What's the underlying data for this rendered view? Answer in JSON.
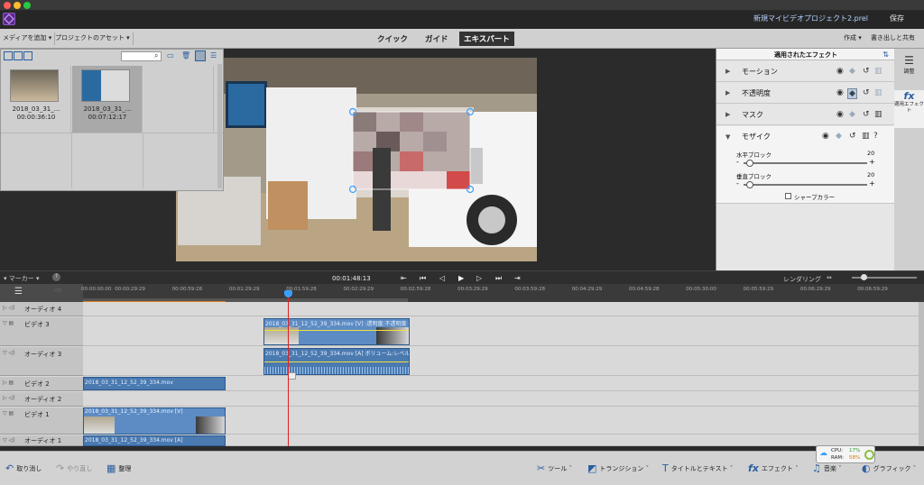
{
  "app": {
    "doc_title": "新規マイビデオプロジェクト2.prel",
    "save_label": "保存"
  },
  "tabbar": {
    "add_media": "メディアを追加",
    "project_assets": "プロジェクトのアセット",
    "modes": [
      "クイック",
      "ガイド",
      "エキスパート"
    ],
    "active_mode": "エキスパート",
    "create": "作成",
    "export_share": "書き出しと共有"
  },
  "assets": [
    {
      "name": "2018_03_31_...",
      "duration": "00:00:36:10"
    },
    {
      "name": "2018_03_31_...",
      "duration": "00:07:12:17"
    }
  ],
  "effects_panel": {
    "title": "適用されたエフェクト",
    "effects": [
      "モーション",
      "不透明度",
      "マスク",
      "モザイク"
    ],
    "mosaic": {
      "horizontal_label": "水平ブロック",
      "horizontal_value": "20",
      "vertical_label": "垂直ブロック",
      "vertical_value": "20",
      "sharp_color_label": "シャープカラー",
      "horizontal_level": 0.05,
      "vertical_level": 0.05
    }
  },
  "right_rail": {
    "adjust_label": "調整",
    "applied_fx_label": "適用エフェクト"
  },
  "transport": {
    "marker_label": "マーカー",
    "timecode": "00:01:48:13",
    "render_label": "レンダリング"
  },
  "ruler": {
    "ticks": [
      "00:00:00:00",
      "00:00:29:29",
      "00:00:59:28",
      "00:01:29:29",
      "00:01:59:28",
      "00:02:29:29",
      "00:02:59:28",
      "00:03:29:29",
      "00:03:59:28",
      "00:04:29:29",
      "00:04:59:28",
      "00:05:30:00",
      "00:05:59:29",
      "00:06:29:29",
      "00:06:59:29"
    ]
  },
  "tracks": [
    {
      "name": "オーディオ 4"
    },
    {
      "name": "ビデオ 3"
    },
    {
      "name": "オーディオ 3"
    },
    {
      "name": "ビデオ 2"
    },
    {
      "name": "オーディオ 2"
    },
    {
      "name": "ビデオ 1"
    },
    {
      "name": "オーディオ 1"
    }
  ],
  "clips": {
    "v3": "2018_03_31_12_52_39_334.mov [V] :透明度:不透明度 -",
    "a3": "2018_03_31_12_52_39_334.mov [A] ボリューム:レベル -",
    "v2": "2018_03_31_12_52_39_334.mov",
    "v1": "2018_03_31_12_52_39_334.mov [V]",
    "a1": "2018_03_31_12_52_39_334.mov [A]"
  },
  "bottom": {
    "undo": "取り消し",
    "redo": "やり直し",
    "organize": "整理",
    "tools": "ツール",
    "transitions": "トランジション",
    "titles": "タイトルとテキスト",
    "effects": "エフェクト",
    "audio": "音楽",
    "graphics": "グラフィック"
  },
  "perf": {
    "cpu_label": "CPU:",
    "cpu_value": "17%",
    "ram_label": "RAM:",
    "ram_value": "58%"
  },
  "colors": {
    "accent_blue": "#3aa0ff",
    "clip_blue": "#4a7ab0",
    "playhead_red": "#e02020"
  }
}
